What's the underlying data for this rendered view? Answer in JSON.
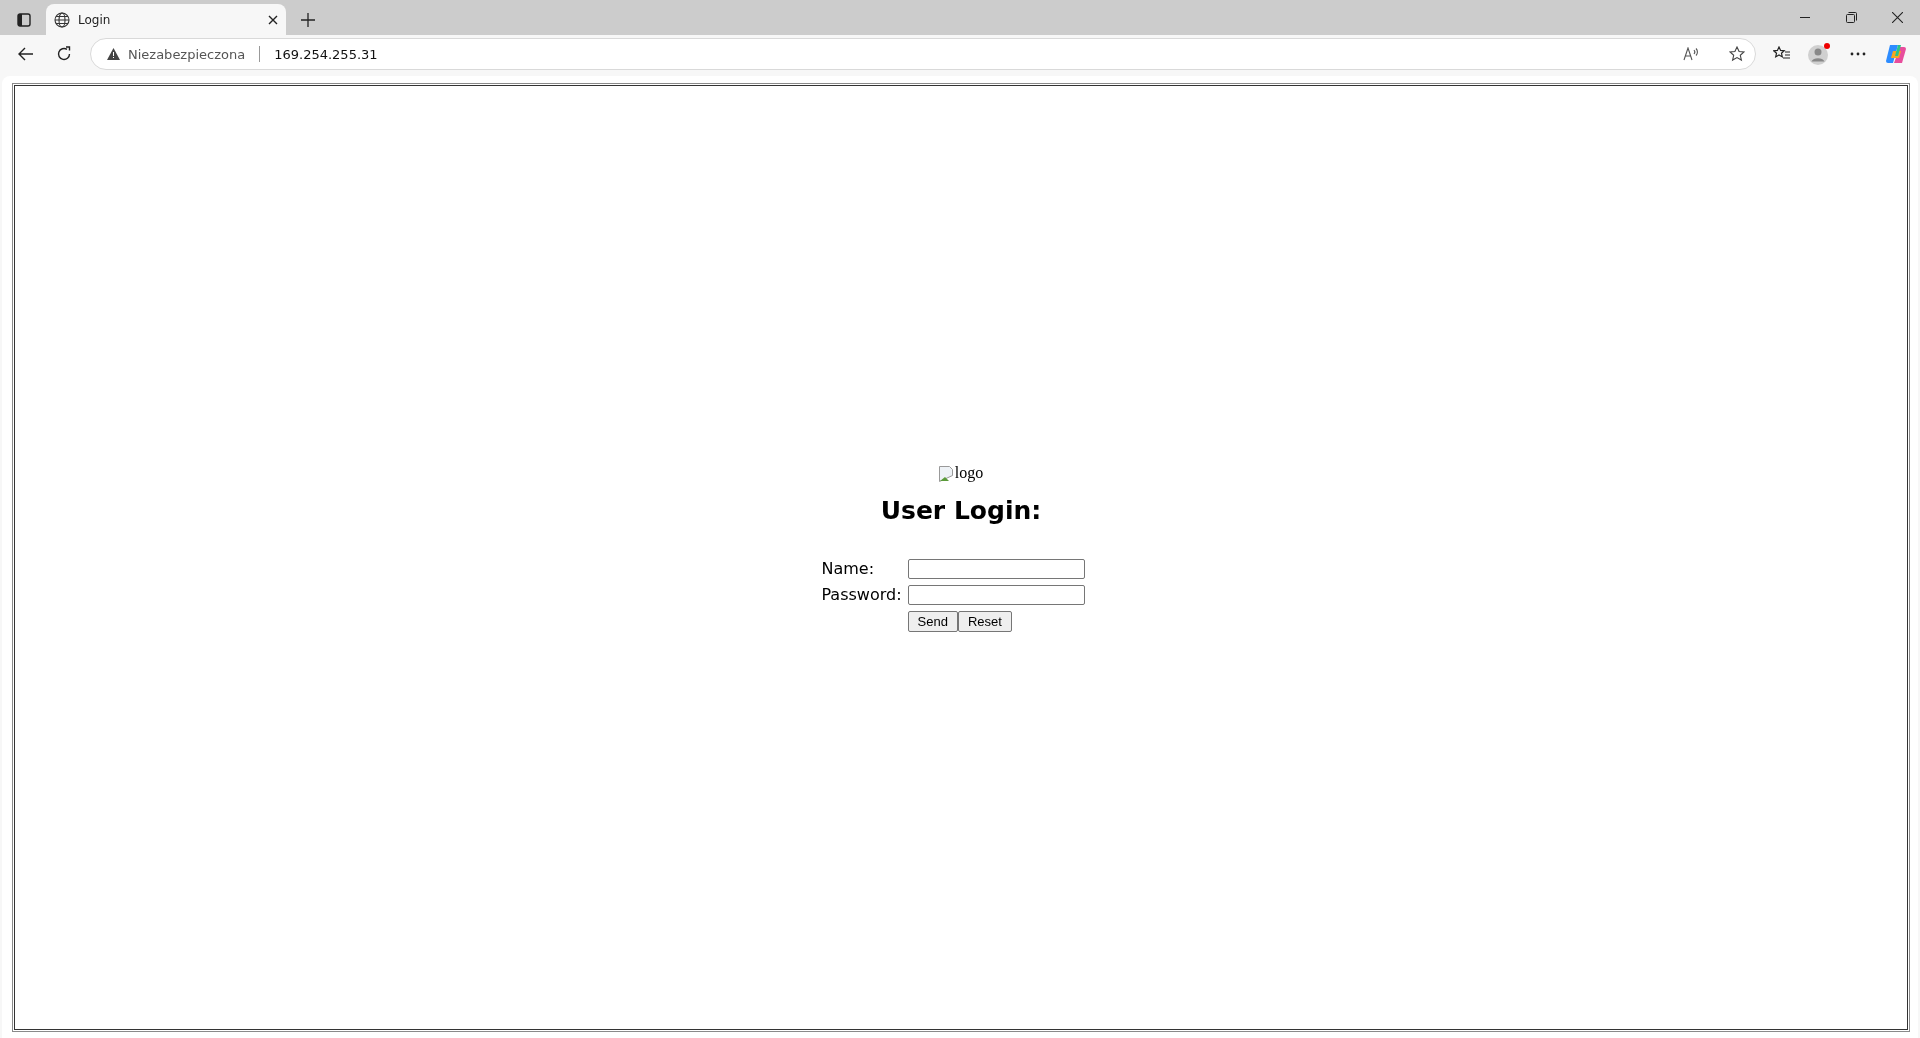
{
  "browser": {
    "tab": {
      "title": "Login"
    },
    "address_bar": {
      "security_label": "Niezabezpieczona",
      "url": "169.254.255.31"
    }
  },
  "page": {
    "logo_alt": "logo",
    "heading": "User Login:",
    "fields": [
      {
        "label": "Name:"
      },
      {
        "label": "Password:"
      }
    ],
    "buttons": [
      "Send",
      "Reset"
    ]
  }
}
